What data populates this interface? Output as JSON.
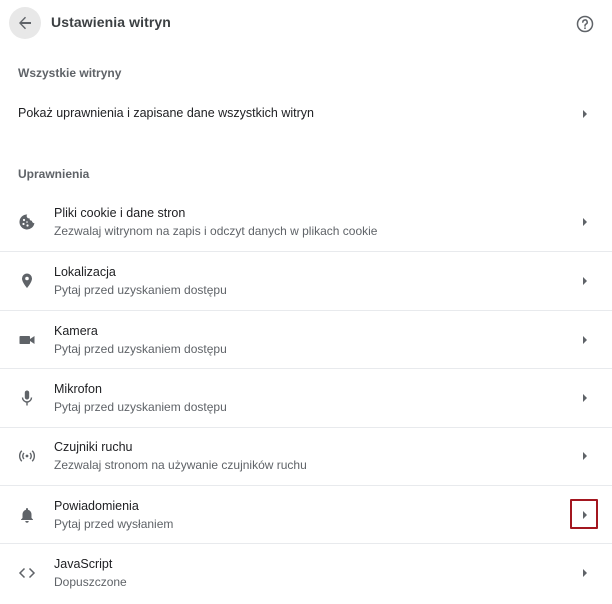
{
  "header": {
    "title": "Ustawienia witryn",
    "back_icon": "arrow-left-icon",
    "help_icon": "help-circle-icon"
  },
  "all_sites": {
    "section_title": "Wszystkie witryny",
    "row_label": "Pokaż uprawnienia i zapisane dane wszystkich witryn"
  },
  "permissions": {
    "section_title": "Uprawnienia",
    "items": [
      {
        "icon": "cookie-icon",
        "title": "Pliki cookie i dane stron",
        "subtitle": "Zezwalaj witrynom na zapis i odczyt danych w plikach cookie"
      },
      {
        "icon": "location-pin-icon",
        "title": "Lokalizacja",
        "subtitle": "Pytaj przed uzyskaniem dostępu"
      },
      {
        "icon": "camera-icon",
        "title": "Kamera",
        "subtitle": "Pytaj przed uzyskaniem dostępu"
      },
      {
        "icon": "microphone-icon",
        "title": "Mikrofon",
        "subtitle": "Pytaj przed uzyskaniem dostępu"
      },
      {
        "icon": "motion-sensors-icon",
        "title": "Czujniki ruchu",
        "subtitle": "Zezwalaj stronom na używanie czujników ruchu"
      },
      {
        "icon": "bell-icon",
        "title": "Powiadomienia",
        "subtitle": "Pytaj przed wysłaniem"
      },
      {
        "icon": "code-icon",
        "title": "JavaScript",
        "subtitle": "Dopuszczone"
      }
    ]
  },
  "colors": {
    "highlight_border": "#a3161f",
    "text_primary": "#202124",
    "text_secondary": "#5f6368",
    "divider": "#e8eaed"
  }
}
